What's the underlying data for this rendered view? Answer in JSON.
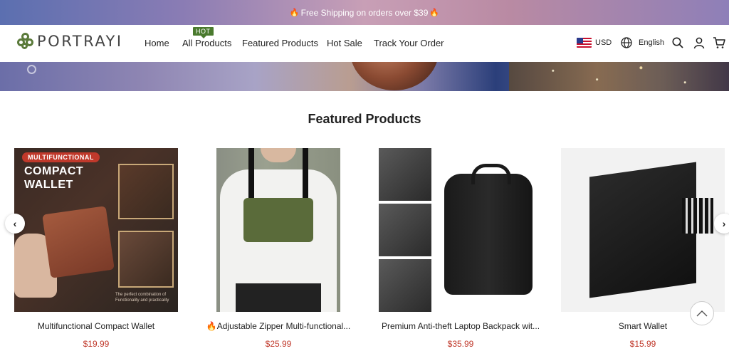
{
  "announcement": {
    "text": "Free Shipping on orders over $39",
    "flame_icon": "flame-icon"
  },
  "header": {
    "logo_text": "PORTRAYI",
    "nav": [
      {
        "label": "Home"
      },
      {
        "label": "All Products",
        "badge": "HOT"
      },
      {
        "label": "Featured Products"
      },
      {
        "label": "Hot Sale"
      },
      {
        "label": "Track Your Order"
      }
    ],
    "currency": "USD",
    "language": "English",
    "icons": [
      "us-flag-icon",
      "globe-icon",
      "search-icon",
      "account-icon",
      "cart-icon"
    ]
  },
  "featured": {
    "title": "Featured Products",
    "products": [
      {
        "name": "Multifunctional Compact Wallet",
        "price": "$19.99",
        "image_tag": "MULTIFUNCTIONAL",
        "image_headline_1": "COMPACT",
        "image_headline_2": "WALLET",
        "image_caption": "The perfect combination of Functionality and practicality"
      },
      {
        "name": "Adjustable Zipper Multi-functional...",
        "price": "$25.99",
        "flame_icon": "flame-icon"
      },
      {
        "name": "Premium Anti-theft Laptop Backpack wit...",
        "price": "$35.99"
      },
      {
        "name": "Smart Wallet",
        "price": "$15.99"
      }
    ]
  },
  "colors": {
    "accent_green": "#4a7a2e",
    "price_red": "#c0392b"
  }
}
